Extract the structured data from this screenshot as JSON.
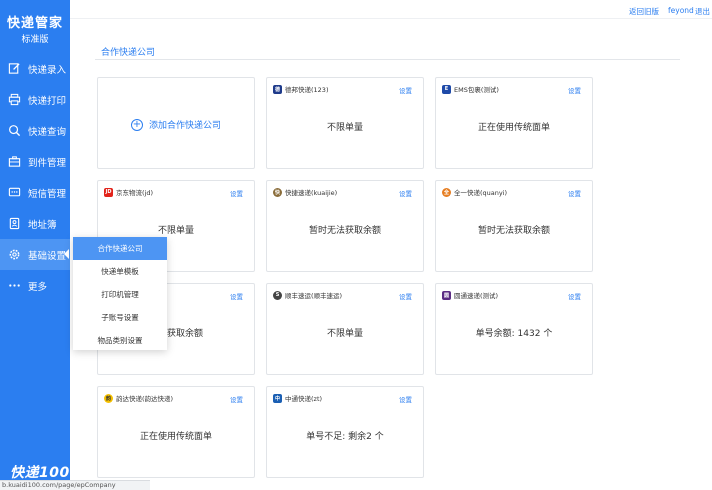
{
  "app": {
    "title": "快递管家",
    "edition": "标准版",
    "footer_logo": "快递100"
  },
  "colors": {
    "accent": "#2b7ef0",
    "sidebar_bg": "#2b7ef0",
    "active_bg": "#4d95f3"
  },
  "top_links": {
    "back": "返回旧版",
    "user": "feyond",
    "logout": "退出"
  },
  "sidebar": {
    "items": [
      {
        "label": "快递录入",
        "icon": "edit-icon"
      },
      {
        "label": "快递打印",
        "icon": "printer-icon"
      },
      {
        "label": "快递查询",
        "icon": "search-icon"
      },
      {
        "label": "到件管理",
        "icon": "briefcase-icon"
      },
      {
        "label": "短信管理",
        "icon": "message-icon"
      },
      {
        "label": "地址簿",
        "icon": "addressbook-icon"
      },
      {
        "label": "基础设置",
        "icon": "gear-icon"
      },
      {
        "label": "更多",
        "icon": "more-icon"
      }
    ]
  },
  "submenu": {
    "items": [
      "合作快递公司",
      "快递单模板",
      "打印机管理",
      "子账号设置",
      "物品类别设置"
    ],
    "selected": "合作快递公司"
  },
  "main": {
    "section_title": "合作快递公司",
    "add_label": "添加合作快递公司",
    "setting_label": "设置",
    "cards": [
      {
        "name": "德邦快递(123)",
        "status": "不限单量",
        "logo": "debang-logo",
        "logo_color": "#1e3a8a"
      },
      {
        "name": "EMS包裹(测试)",
        "status": "正在使用传统面单",
        "logo": "ems-logo",
        "logo_color": "#1f4aa8"
      },
      {
        "name": "京东物流(jd)",
        "status": "不限单量",
        "logo": "jd-logo",
        "logo_color": "#e2231a"
      },
      {
        "name": "快捷速递(kuaijie)",
        "status": "暂时无法获取余额",
        "logo": "kuaijie-logo",
        "logo_color": "#8a6d3b"
      },
      {
        "name": "全一快递(quanyi)",
        "status": "暂时无法获取余额",
        "logo": "quanyi-logo",
        "logo_color": "#e67e22"
      },
      {
        "name": "",
        "status": "无法获取余额",
        "logo": "",
        "logo_color": ""
      },
      {
        "name": "顺丰速运(顺丰速运)",
        "status": "不限单量",
        "logo": "sf-logo",
        "logo_color": "#444444"
      },
      {
        "name": "圆通速递(测试)",
        "status": "单号余额: 1432 个",
        "logo": "yuantong-logo",
        "logo_color": "#5b2c83"
      },
      {
        "name": "韵达快递(韵达快递)",
        "status": "正在使用传统面单",
        "logo": "yunda-logo",
        "logo_color": "#f5c000"
      },
      {
        "name": "中通快递(zt)",
        "status": "单号不足: 剩余2 个",
        "logo": "zhongtong-logo",
        "logo_color": "#1b5fb3"
      }
    ]
  },
  "status_url": "b.kuaidi100.com/page/epCompany"
}
